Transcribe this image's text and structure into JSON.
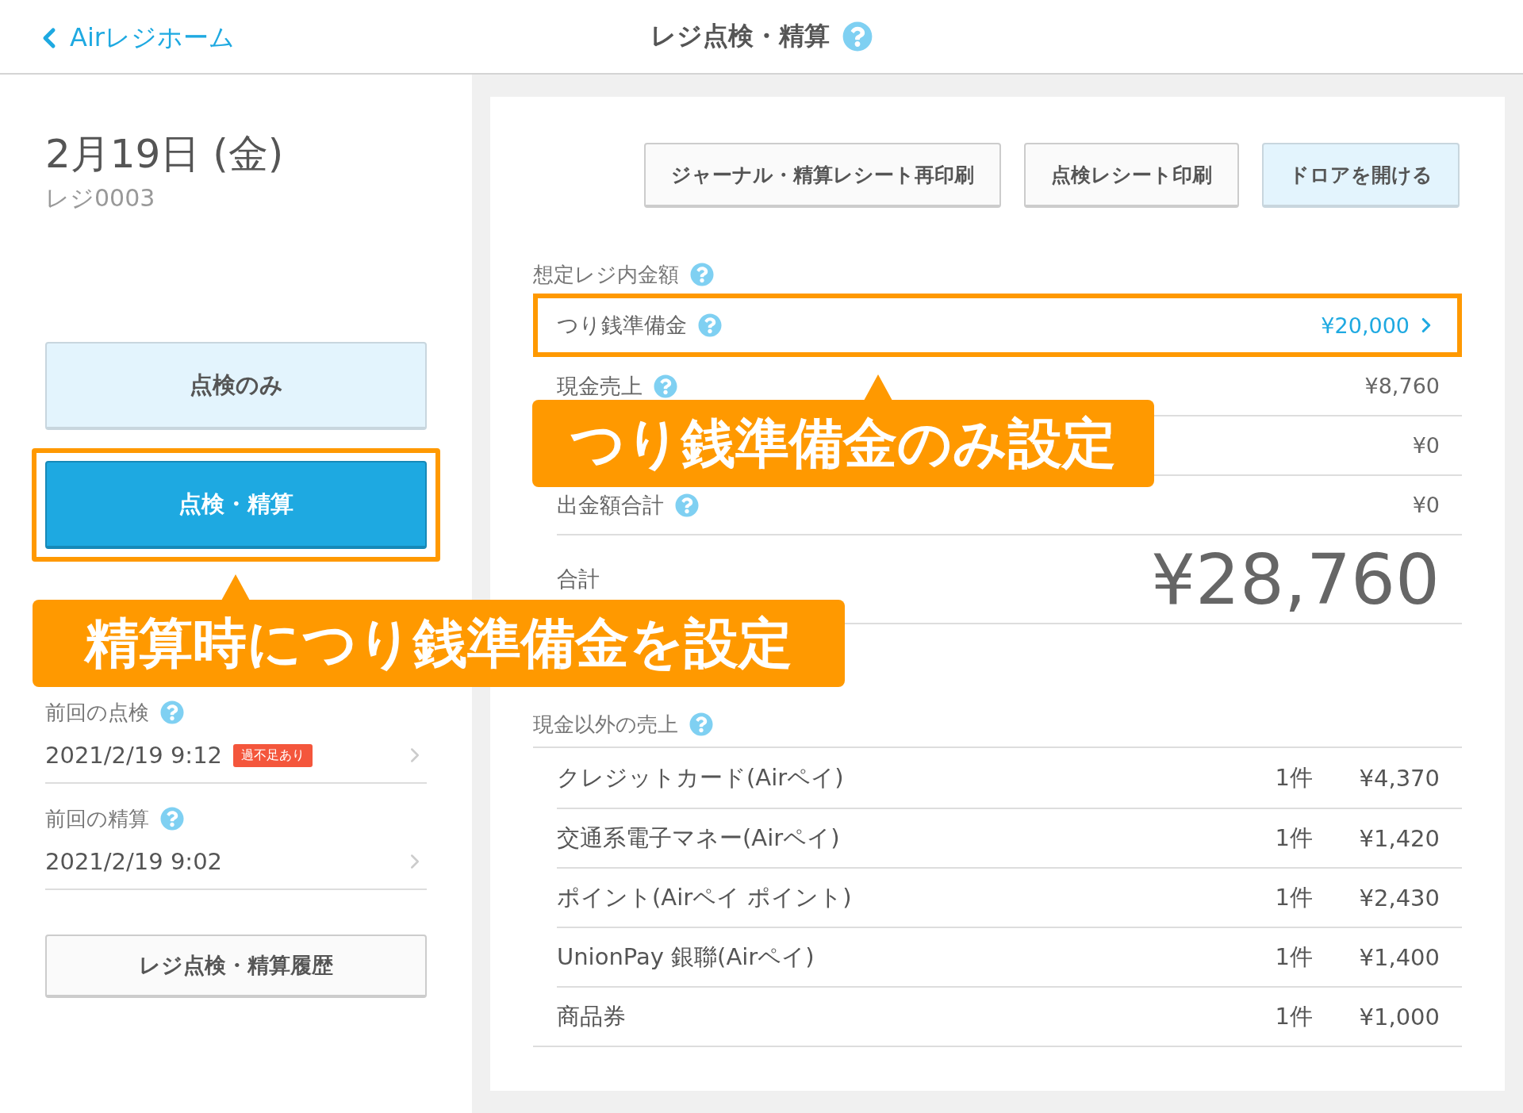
{
  "header": {
    "back_link": "Airレジホーム",
    "title": "レジ点検・精算"
  },
  "left": {
    "date": "2月19日 (金)",
    "register": "レジ0003",
    "actions": [
      {
        "label": "点検のみ",
        "primary": false,
        "highlighted": false
      },
      {
        "label": "点検・精算",
        "primary": true,
        "highlighted": true
      }
    ],
    "callout": "精算時につり銭準備金を設定",
    "history": [
      {
        "heading": "前回の点検",
        "date": "2021/2/19 9:12",
        "badge": "過不足あり"
      },
      {
        "heading": "前回の精算",
        "date": "2021/2/19 9:02"
      }
    ],
    "history_button": "レジ点検・精算履歴"
  },
  "right": {
    "buttons": [
      {
        "label": "ジャーナル・精算レシート再印刷",
        "accent": false
      },
      {
        "label": "点検レシート印刷",
        "accent": false
      },
      {
        "label": "ドロアを開ける",
        "accent": true
      }
    ],
    "expected": {
      "heading": "想定レジ内金額",
      "rows": [
        {
          "label": "つり銭準備金",
          "help": true,
          "amount": "¥20,000",
          "link": true,
          "highlighted": true
        },
        {
          "label": "現金売上",
          "help": true,
          "amount": "¥8,760",
          "link": false,
          "highlighted": false
        },
        {
          "amount": "¥0",
          "link": false,
          "highlighted": false
        },
        {
          "label": "出金額合計",
          "help": true,
          "amount": "¥0",
          "link": false,
          "highlighted": false
        }
      ],
      "total_label": "合計",
      "total": "¥28,760"
    },
    "callout": "つり銭準備金のみ設定",
    "other": {
      "heading": "現金以外の売上",
      "rows": [
        {
          "label": "クレジットカード(Airペイ)",
          "count": "1件",
          "amount": "¥4,370"
        },
        {
          "label": "交通系電子マネー(Airペイ)",
          "count": "1件",
          "amount": "¥1,420"
        },
        {
          "label": "ポイント(Airペイ ポイント)",
          "count": "1件",
          "amount": "¥2,430"
        },
        {
          "label": "UnionPay 銀聯(Airペイ)",
          "count": "1件",
          "amount": "¥1,400"
        },
        {
          "label": "商品券",
          "count": "1件",
          "amount": "¥1,000"
        }
      ]
    }
  }
}
